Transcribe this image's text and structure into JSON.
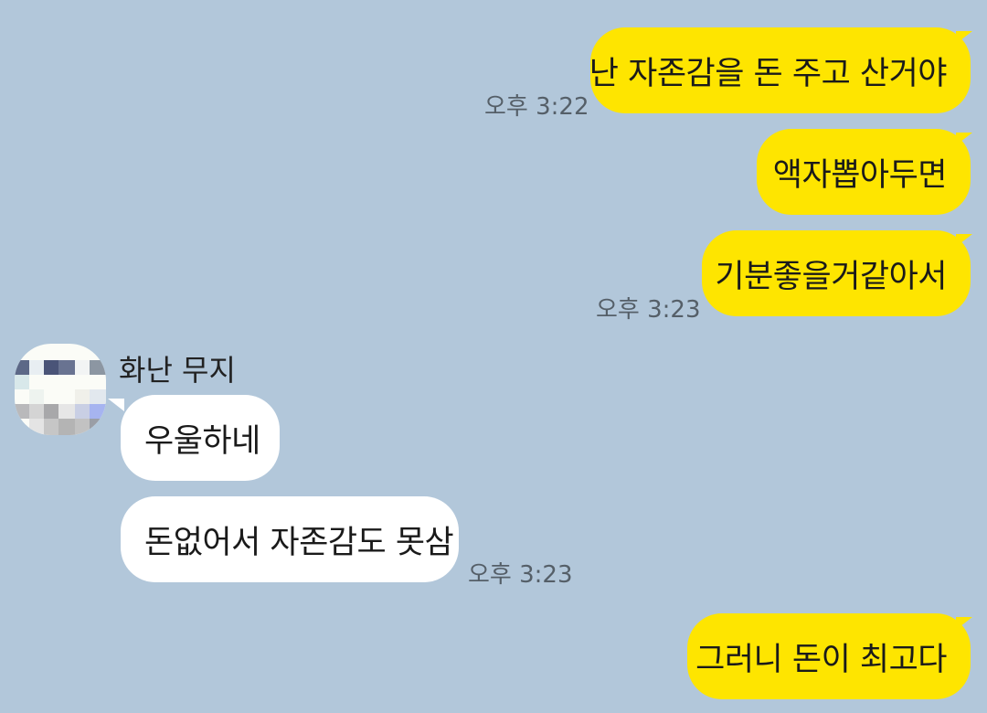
{
  "colors": {
    "background": "#b2c7da",
    "my_bubble": "#fee500",
    "other_bubble": "#ffffff",
    "timestamp": "#555f68"
  },
  "contact": {
    "name": "화난 무지",
    "avatar_icon": "pixelated-avatar-icon"
  },
  "messages": [
    {
      "sender": "me",
      "text": "난 자존감을 돈 주고 산거야",
      "time": "오후 3:22"
    },
    {
      "sender": "me",
      "text": "액자뽑아두면",
      "time": ""
    },
    {
      "sender": "me",
      "text": "기분좋을거같아서",
      "time": "오후 3:23"
    },
    {
      "sender": "other",
      "text": "우울하네",
      "time": ""
    },
    {
      "sender": "other",
      "text": "돈없어서 자존감도 못삼",
      "time": "오후 3:23"
    },
    {
      "sender": "me",
      "text": "그러니 돈이 최고다",
      "time": ""
    }
  ]
}
